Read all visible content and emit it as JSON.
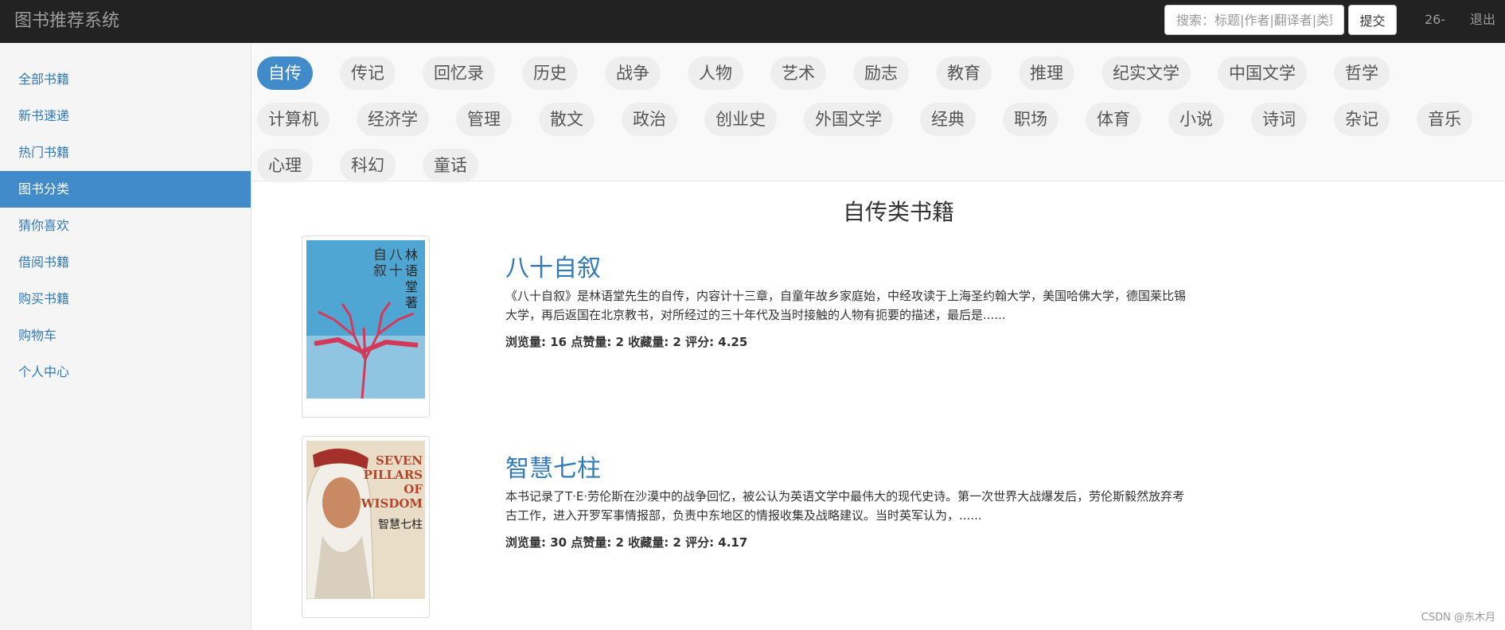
{
  "navbar": {
    "brand": "图书推荐系统",
    "search_placeholder": "搜索：标题|作者|翻译者|类别",
    "search_button": "提交",
    "user": "26-",
    "logout": "退出"
  },
  "sidebar": {
    "items": [
      {
        "label": "全部书籍"
      },
      {
        "label": "新书速递"
      },
      {
        "label": "热门书籍"
      },
      {
        "label": "图书分类",
        "active": true
      },
      {
        "label": "猜你喜欢"
      },
      {
        "label": "借阅书籍"
      },
      {
        "label": "购买书籍"
      },
      {
        "label": "购物车"
      },
      {
        "label": "个人中心"
      }
    ]
  },
  "categories": [
    "自传",
    "传记",
    "回忆录",
    "历史",
    "战争",
    "人物",
    "艺术",
    "励志",
    "教育",
    "推理",
    "纪实文学",
    "中国文学",
    "哲学",
    "计算机",
    "经济学",
    "管理",
    "散文",
    "政治",
    "创业史",
    "外国文学",
    "经典",
    "职场",
    "体育",
    "小说",
    "诗词",
    "杂记",
    "音乐",
    "心理",
    "科幻",
    "童话"
  ],
  "active_category": "自传",
  "section_title": "自传类书籍",
  "books": [
    {
      "title": "八十自叙",
      "desc": "《八十自叙》是林语堂先生的自传，内容计十三章，自童年故乡家庭始，中经攻读于上海圣约翰大学，美国哈佛大学，德国莱比锡大学，再后返国在北京教书，对所经过的三十年代及当时接触的人物有扼要的描述，最后是......",
      "stats": "浏览量: 16 点赞量: 2 收藏量: 2 评分: 4.25",
      "cover_text": [
        "八",
        "十",
        "自",
        "叙",
        "林",
        "语",
        "堂",
        "著"
      ],
      "cover_colors": {
        "sky": "#4fa6d3",
        "tree": "#d33a5a"
      }
    },
    {
      "title": "智慧七柱",
      "desc": "本书记录了T·E·劳伦斯在沙漠中的战争回忆，被公认为英语文学中最伟大的现代史诗。第一次世界大战爆发后，劳伦斯毅然放弃考古工作，进入开罗军事情报部，负责中东地区的情报收集及战略建议。当时英军认为，......",
      "stats": "浏览量: 30 点赞量: 2 收藏量: 2 评分: 4.17",
      "cover_text": [
        "SEVEN",
        "PILLARS",
        "OF",
        "WISDOM",
        "智慧七柱"
      ],
      "cover_colors": {
        "bg": "#e9ddc7",
        "title": "#b0462c"
      }
    }
  ],
  "watermark": "CSDN @东木月"
}
